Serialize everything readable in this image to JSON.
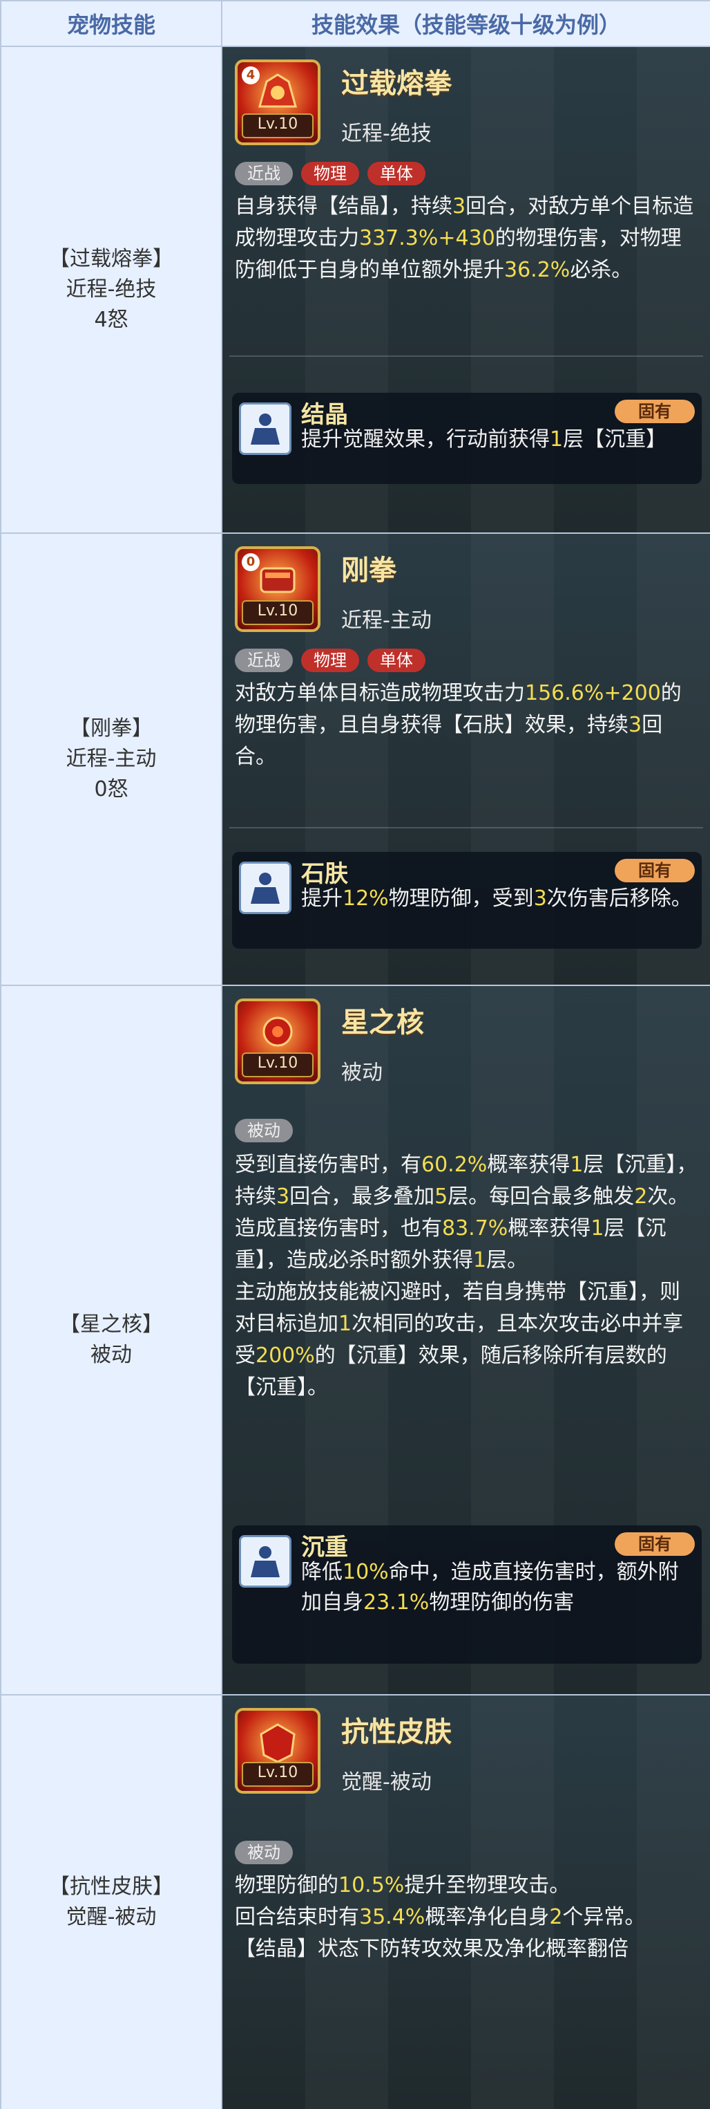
{
  "header": {
    "col1": "宠物技能",
    "col2": "技能效果（技能等级十级为例）"
  },
  "colors": {
    "highlight": "#f4dd52",
    "header_text": "#4a6aa6",
    "left_bg": "#e7f0ff",
    "tag_red": "#c0302a",
    "tag_gray": "#8e9095",
    "badge": "#f0a45a"
  },
  "rows": [
    {
      "left": {
        "name": "【过载熔拳】",
        "type": "近程-绝技",
        "cost": "4怒"
      },
      "icon_num": "4",
      "icon_level": "Lv.10",
      "name": "过载熔拳",
      "type": "近程-绝技",
      "tags": [
        "近战",
        "物理",
        "单体"
      ],
      "desc": [
        {
          "t": "自身获得【结晶】，持续"
        },
        {
          "t": "3",
          "h": true
        },
        {
          "t": "回合，对敌方单个目标造成物理攻击力"
        },
        {
          "t": "337.3%+430",
          "h": true
        },
        {
          "t": "的物理伤害，对物理防御低于自身的单位额外提升"
        },
        {
          "t": "36.2%",
          "h": true
        },
        {
          "t": "必杀。"
        }
      ],
      "sub": {
        "icon": "figure-icon",
        "name": "结晶",
        "badge": "固有",
        "desc": [
          {
            "t": "提升觉醒效果，行动前获得"
          },
          {
            "t": "1",
            "h": true
          },
          {
            "t": "层【沉重】"
          }
        ]
      }
    },
    {
      "left": {
        "name": "【刚拳】",
        "type": "近程-主动",
        "cost": "0怒"
      },
      "icon_num": "0",
      "icon_level": "Lv.10",
      "name": "刚拳",
      "type": "近程-主动",
      "tags": [
        "近战",
        "物理",
        "单体"
      ],
      "desc": [
        {
          "t": "对敌方单体目标造成物理攻击力"
        },
        {
          "t": "156.6%+200",
          "h": true
        },
        {
          "t": "的物理伤害，且自身获得【石肤】效果，持续"
        },
        {
          "t": "3",
          "h": true
        },
        {
          "t": "回合。"
        }
      ],
      "sub": {
        "icon": "figure-icon",
        "name": "石肤",
        "badge": "固有",
        "desc": [
          {
            "t": "提升"
          },
          {
            "t": "12%",
            "h": true
          },
          {
            "t": "物理防御，受到"
          },
          {
            "t": "3",
            "h": true
          },
          {
            "t": "次伤害后移除。"
          }
        ]
      }
    },
    {
      "left": {
        "name": "【星之核】",
        "type": "被动",
        "cost": ""
      },
      "icon_num": "",
      "icon_level": "Lv.10",
      "name": "星之核",
      "type": "被动",
      "tags": [
        "被动"
      ],
      "desc": [
        {
          "t": "受到直接伤害时，有"
        },
        {
          "t": "60.2%",
          "h": true
        },
        {
          "t": "概率获得"
        },
        {
          "t": "1",
          "h": true
        },
        {
          "t": "层【沉重】，持续"
        },
        {
          "t": "3",
          "h": true
        },
        {
          "t": "回合，最多叠加"
        },
        {
          "t": "5",
          "h": true
        },
        {
          "t": "层。每回合最多触发"
        },
        {
          "t": "2",
          "h": true
        },
        {
          "t": "次。"
        },
        {
          "t": "\n造成直接伤害时，也有"
        },
        {
          "t": "83.7%",
          "h": true
        },
        {
          "t": "概率获得"
        },
        {
          "t": "1",
          "h": true
        },
        {
          "t": "层【沉重】，造成必杀时额外获得"
        },
        {
          "t": "1",
          "h": true
        },
        {
          "t": "层。"
        },
        {
          "t": "\n主动施放技能被闪避时，若自身携带【沉重】，则对目标追加"
        },
        {
          "t": "1",
          "h": true
        },
        {
          "t": "次相同的攻击，且本次攻击必中并享受"
        },
        {
          "t": "200%",
          "h": true
        },
        {
          "t": "的【沉重】效果，随后移除所有层数的【沉重】。"
        }
      ],
      "sub": {
        "icon": "figure-icon",
        "name": "沉重",
        "badge": "固有",
        "desc": [
          {
            "t": "降低"
          },
          {
            "t": "10%",
            "h": true
          },
          {
            "t": "命中，造成直接伤害时，额外附加自身"
          },
          {
            "t": "23.1%",
            "h": true
          },
          {
            "t": "物理防御的伤害"
          }
        ]
      }
    },
    {
      "left": {
        "name": "【抗性皮肤】",
        "type": "觉醒-被动",
        "cost": ""
      },
      "icon_num": "",
      "icon_level": "Lv.10",
      "name": "抗性皮肤",
      "type": "觉醒-被动",
      "tags": [
        "被动"
      ],
      "desc": [
        {
          "t": "物理防御的"
        },
        {
          "t": "10.5%",
          "h": true
        },
        {
          "t": "提升至物理攻击。"
        },
        {
          "t": "\n回合结束时有"
        },
        {
          "t": "35.4%",
          "h": true
        },
        {
          "t": "概率净化自身"
        },
        {
          "t": "2",
          "h": true
        },
        {
          "t": "个异常。"
        },
        {
          "t": "\n【结晶】状态下防转攻效果及净化概率翻倍"
        }
      ],
      "sub": null
    }
  ]
}
